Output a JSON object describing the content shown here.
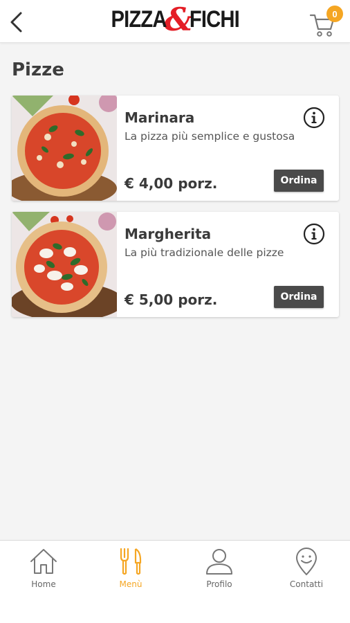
{
  "header": {
    "logo_left": "PIZZA",
    "logo_amp": "&",
    "logo_right": "FICHI",
    "cart_count": "0",
    "accent_color": "#f5a623",
    "brand_red": "#e41e26"
  },
  "section": {
    "title": "Pizze"
  },
  "products": [
    {
      "name": "Marinara",
      "description": "La pizza più semplice e gustosa",
      "price": "€ 4,00 porz.",
      "order_label": "Ordina",
      "image": "pizza-marinara-photo",
      "info_icon": "info-icon"
    },
    {
      "name": "Margherita",
      "description": "La più tradizionale delle pizze",
      "price": "€ 5,00 porz.",
      "order_label": "Ordina",
      "image": "pizza-margherita-photo",
      "info_icon": "info-icon"
    }
  ],
  "bottom_nav": {
    "items": [
      {
        "label": "Home",
        "icon": "home-icon",
        "active": false
      },
      {
        "label": "Menù",
        "icon": "fork-knife-icon",
        "active": true
      },
      {
        "label": "Profilo",
        "icon": "user-icon",
        "active": false
      },
      {
        "label": "Contatti",
        "icon": "location-pin-icon",
        "active": false
      }
    ]
  }
}
